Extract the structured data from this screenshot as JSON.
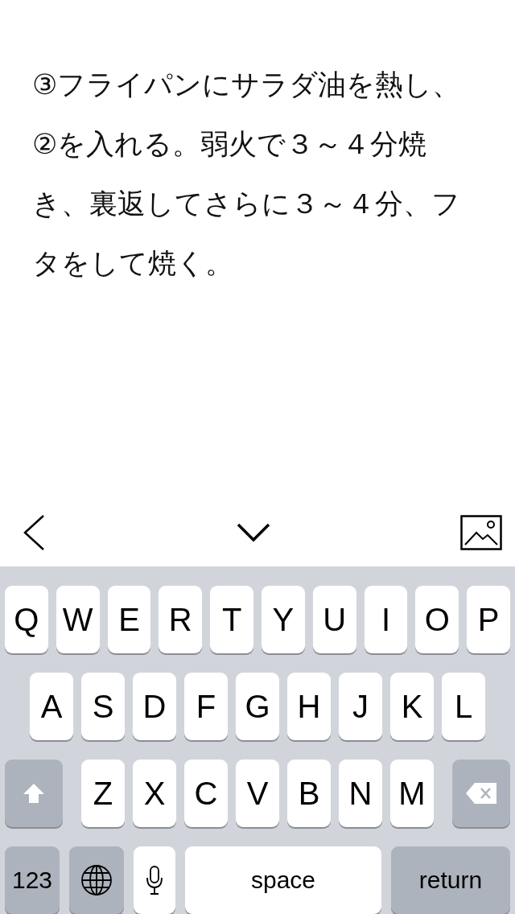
{
  "note": {
    "text": "③フライパンにサラダ油を熱し、②を入れる。弱火で３～４分焼き、裏返してさらに３～４分、フタをして焼く。"
  },
  "keyboard": {
    "rows": [
      [
        "Q",
        "W",
        "E",
        "R",
        "T",
        "Y",
        "U",
        "I",
        "O",
        "P"
      ],
      [
        "A",
        "S",
        "D",
        "F",
        "G",
        "H",
        "J",
        "K",
        "L"
      ],
      [
        "Z",
        "X",
        "C",
        "V",
        "B",
        "N",
        "M"
      ]
    ],
    "numbers_key": "123",
    "space_key": "space",
    "return_key": "return"
  }
}
